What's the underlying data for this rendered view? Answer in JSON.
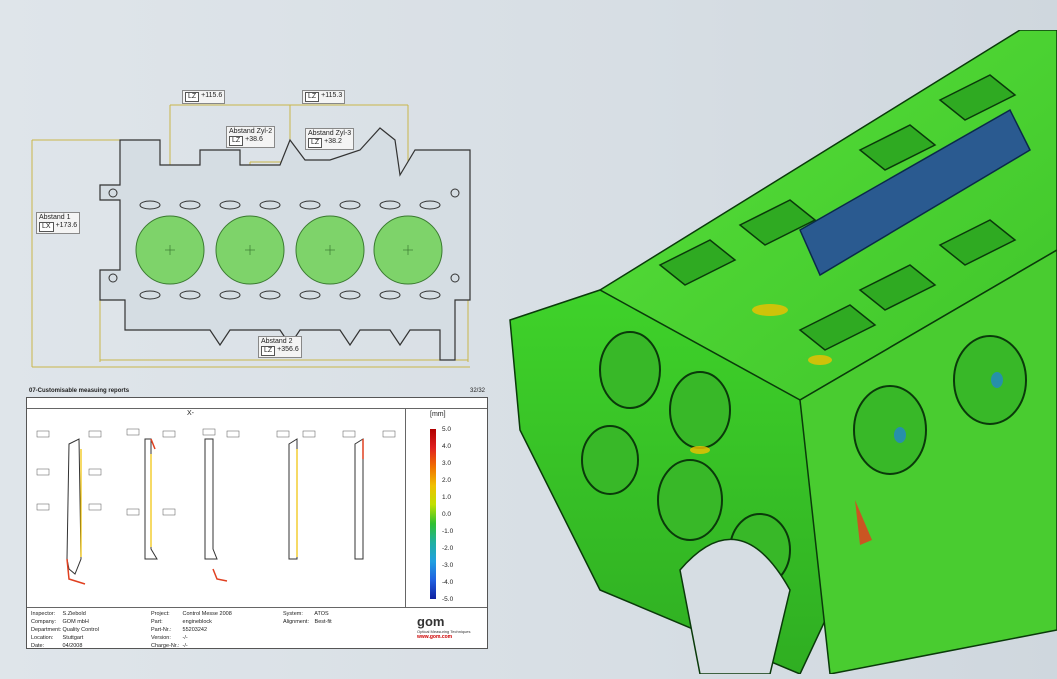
{
  "drawing": {
    "dims": [
      {
        "name": "",
        "axis": "LZ",
        "value": "+115.6"
      },
      {
        "name": "",
        "axis": "LZ",
        "value": "+115.3"
      },
      {
        "name": "Abstand Zyl-2",
        "axis": "LZ",
        "value": "+38.6"
      },
      {
        "name": "Abstand Zyl-3",
        "axis": "LZ",
        "value": "+38.2"
      },
      {
        "name": "Abstand 1",
        "axis": "LX",
        "value": "+173.6"
      },
      {
        "name": "Abstand 2",
        "axis": "LZ",
        "value": "+356.6"
      }
    ]
  },
  "report": {
    "title": "07-Customisable measuing reports",
    "page": "32/32",
    "plot_title": "X-",
    "legend": {
      "unit": "[mm]",
      "ticks": [
        "5.0",
        "4.0",
        "3.0",
        "2.0",
        "1.0",
        "0.0",
        "-1.0",
        "-2.0",
        "-3.0",
        "-4.0",
        "-5.0"
      ],
      "colors": [
        "#b00000",
        "#e02020",
        "#f07000",
        "#f0c000",
        "#c0e000",
        "#30c030",
        "#20b0a0",
        "#20a0e0",
        "#2060e0",
        "#1020a0"
      ]
    },
    "info": {
      "col1": [
        [
          "Inspector:",
          "S.Ziebold"
        ],
        [
          "Company:",
          "GOM mbH"
        ],
        [
          "Department:",
          "Quality Control"
        ],
        [
          "Location:",
          "Stuttgart"
        ],
        [
          "Date:",
          "04/2008"
        ]
      ],
      "col2": [
        [
          "Project:",
          "Control Messe 2008"
        ],
        [
          "Part:",
          "engineblock"
        ],
        [
          "Part-Nr.:",
          "55203242"
        ],
        [
          "Version:",
          "-/-"
        ],
        [
          "Charge-Nr.:",
          "-/-"
        ]
      ],
      "col3": [
        [
          "System:",
          "ATOS"
        ],
        [
          "Alignment:",
          "Best-fit"
        ]
      ]
    },
    "logo": {
      "name": "gom",
      "tagline": "Optical Measuring Techniques",
      "url": "www.gom.com"
    }
  },
  "colors": {
    "cylinder_fill": "#7ed36a",
    "dimension_line": "#c9b64a",
    "part_green": "#3fd22a",
    "part_dark": "#2a5a90"
  }
}
